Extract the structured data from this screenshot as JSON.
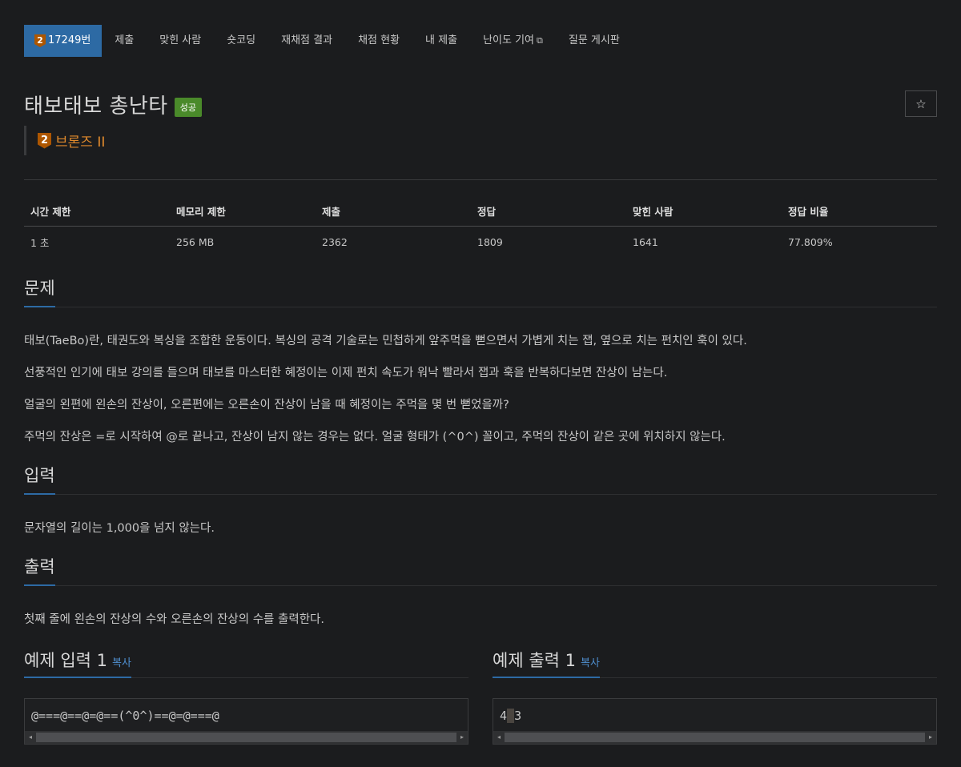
{
  "nav": {
    "tier_badge": "2",
    "problem_number": "17249번",
    "items": [
      "제출",
      "맞힌 사람",
      "숏코딩",
      "재채점 결과",
      "채점 현황",
      "내 제출",
      "난이도 기여",
      "질문 게시판"
    ]
  },
  "problem": {
    "title": "태보태보 총난타",
    "status": "성공",
    "tier_badge": "2",
    "tier": "브론즈 II"
  },
  "stats": {
    "headers": [
      "시간 제한",
      "메모리 제한",
      "제출",
      "정답",
      "맞힌 사람",
      "정답 비율"
    ],
    "values": [
      "1 초",
      "256 MB",
      "2362",
      "1809",
      "1641",
      "77.809%"
    ]
  },
  "sections": {
    "description_title": "문제",
    "description": [
      "태보(TaeBo)란, 태권도와 복싱을 조합한 운동이다. 복싱의 공격 기술로는 민첩하게 앞주먹을 뻗으면서 가볍게 치는 잽, 옆으로 치는 펀치인 훅이 있다.",
      "선풍적인 인기에 태보 강의를 들으며 태보를 마스터한 혜정이는 이제 펀치 속도가 워낙 빨라서 잽과 훅을 반복하다보면 잔상이 남는다.",
      "얼굴의 왼편에 왼손의 잔상이, 오른편에는 오른손이 잔상이 남을 때 혜정이는 주먹을 몇 번 뻗었을까?",
      "주먹의 잔상은 =로 시작하여 @로 끝나고, 잔상이 남지 않는 경우는 없다. 얼굴 형태가 (^0^) 꼴이고, 주먹의 잔상이 같은 곳에 위치하지 않는다."
    ],
    "input_title": "입력",
    "input": "문자열의 길이는 1,000을 넘지 않는다.",
    "output_title": "출력",
    "output": "첫째 줄에 왼손의 잔상의 수와 오른손의 잔상의 수를 출력한다."
  },
  "samples": {
    "input_title": "예제 입력 1",
    "output_title": "예제 출력 1",
    "copy_label": "복사",
    "input_text": "@===@==@=@==(^0^)==@=@===@",
    "output_left": "4",
    "output_sep": " ",
    "output_right": "3"
  },
  "icons": {
    "star": "☆",
    "external": "⧉",
    "arrow_left": "◂",
    "arrow_right": "▸"
  },
  "colors": {
    "accent": "#2d6aa4",
    "bronze": "#ad5600",
    "tier_text": "#e08a2c",
    "success": "#4a8a2a"
  }
}
